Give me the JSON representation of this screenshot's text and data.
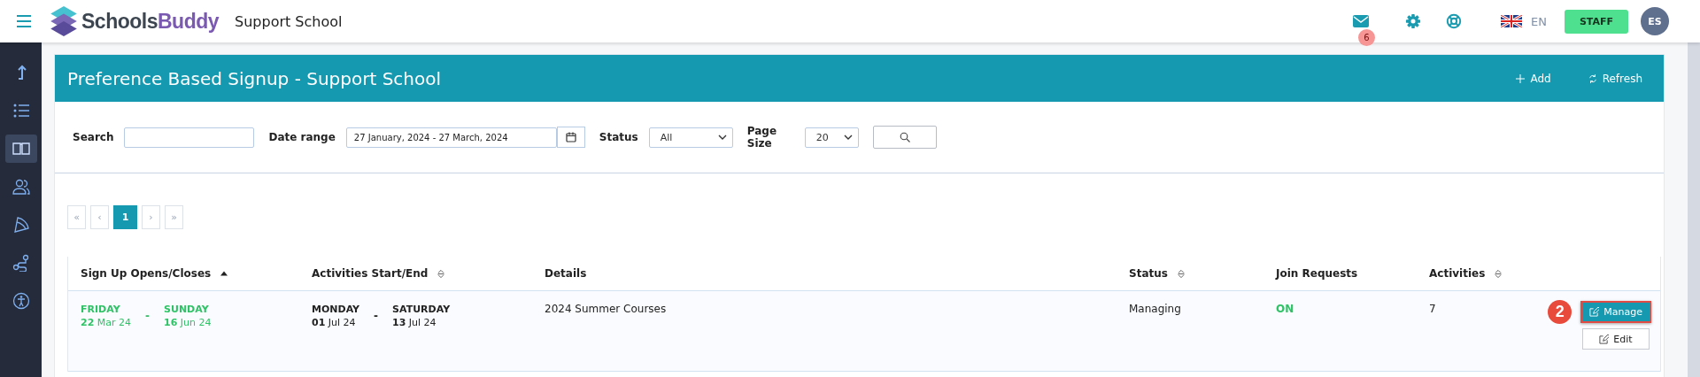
{
  "topbar": {
    "brand_first": "Schools",
    "brand_second": "Buddy",
    "school": "Support School",
    "mail_count": "6",
    "language": "EN",
    "role": "STAFF",
    "avatar": "ES"
  },
  "sidebar": {
    "items": [
      {
        "kind": "upload",
        "selected": false
      },
      {
        "kind": "list",
        "selected": false
      },
      {
        "kind": "book",
        "selected": true
      },
      {
        "kind": "users",
        "selected": false
      },
      {
        "kind": "pizza",
        "selected": false
      },
      {
        "kind": "route",
        "selected": false
      },
      {
        "kind": "accessibility",
        "selected": false
      }
    ]
  },
  "panel": {
    "title": "Preference Based Signup - Support School",
    "add": "Add",
    "refresh": "Refresh"
  },
  "filters": {
    "search_label": "Search",
    "date_label": "Date range",
    "date_value": "27 January, 2024 - 27 March, 2024",
    "status_label": "Status",
    "status_value": "All",
    "page_size_label": "Page Size",
    "page_size_value": "20"
  },
  "pagination": [
    {
      "label": "«",
      "selected": false
    },
    {
      "label": "‹",
      "selected": false
    },
    {
      "label": "1",
      "selected": true
    },
    {
      "label": "›",
      "selected": false
    },
    {
      "label": "»",
      "selected": false
    }
  ],
  "table": {
    "columns": [
      {
        "label": "Sign Up Opens/Closes",
        "kind": "sorted"
      },
      {
        "label": "Activities Start/End",
        "kind": "sortable"
      },
      {
        "label": "Details",
        "kind": "plain"
      },
      {
        "label": "Status",
        "kind": "sortable"
      },
      {
        "label": "Join Requests",
        "kind": "plain"
      },
      {
        "label": "Activities",
        "kind": "sortable"
      }
    ],
    "rows": [
      {
        "signup_open_day": "FRIDAY",
        "signup_open_date": "**22** Mar 24",
        "signup_separator": "-",
        "signup_close_day": "SUNDAY",
        "signup_close_date": "**16** Jun 24",
        "start_day": "MONDAY",
        "start_date": "**01** Jul 24",
        "activities_separator": "-",
        "end_day": "SATURDAY",
        "end_date": "**13** Jul 24",
        "details": "2024 Summer Courses",
        "status": "Managing",
        "join_requests": "ON",
        "activities": "7",
        "step": "2",
        "manage": "Manage",
        "manage_highlighted": true,
        "edit": "Edit"
      }
    ]
  }
}
